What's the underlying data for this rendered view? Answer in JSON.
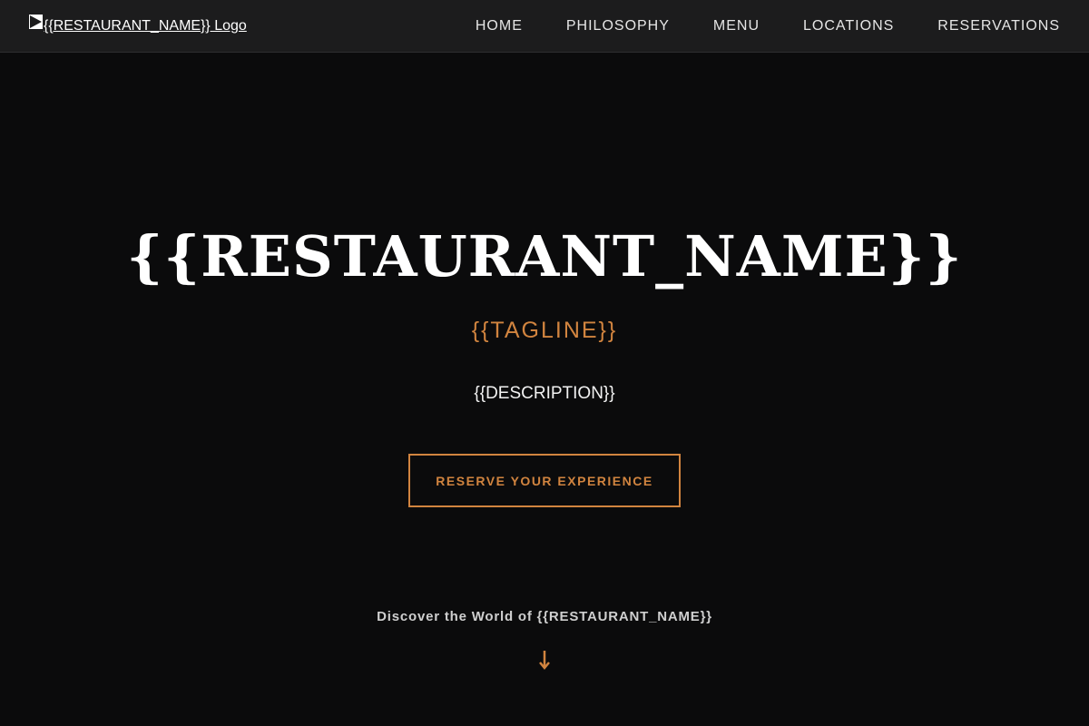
{
  "navbar": {
    "logo_alt": "{{RESTAURANT_NAME}} Logo",
    "links": [
      {
        "label": "HOME"
      },
      {
        "label": "PHILOSOPHY"
      },
      {
        "label": "MENU"
      },
      {
        "label": "LOCATIONS"
      },
      {
        "label": "RESERVATIONS"
      }
    ]
  },
  "hero": {
    "title": "{{RESTAURANT_NAME}}",
    "tagline": "{{TAGLINE}}",
    "description": "{{DESCRIPTION}}",
    "cta_label": "RESERVE YOUR EXPERIENCE"
  },
  "discover": {
    "text": "Discover the World of {{RESTAURANT_NAME}}",
    "icon": "arrow-down-icon"
  },
  "colors": {
    "background": "#0b0b0c",
    "navbar_background": "#1c1c1d",
    "accent": "#d1843f",
    "text": "#ffffff"
  }
}
